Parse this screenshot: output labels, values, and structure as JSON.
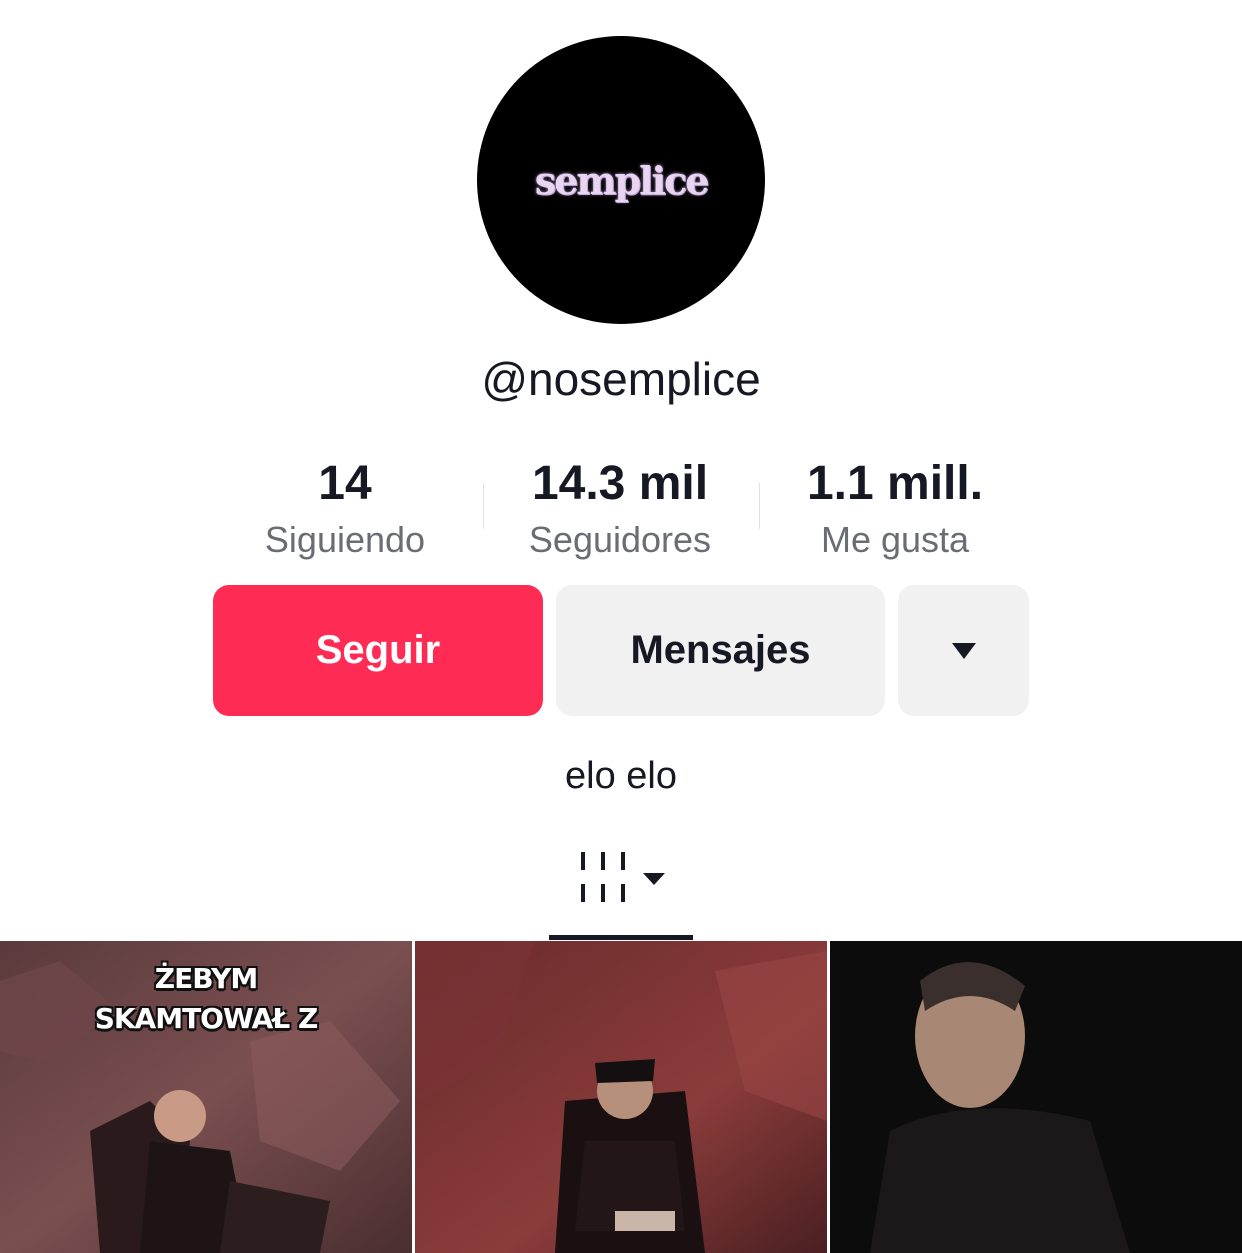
{
  "profile": {
    "avatar_text": "semplice",
    "handle": "@nosemplice",
    "bio": "elo elo"
  },
  "stats": [
    {
      "value": "14",
      "label": "Siguiendo"
    },
    {
      "value": "14.3 mil",
      "label": "Seguidores"
    },
    {
      "value": "1.1 mill.",
      "label": "Me gusta"
    }
  ],
  "actions": {
    "follow_label": "Seguir",
    "message_label": "Mensajes",
    "more_icon": "caret-down-icon"
  },
  "tabs": {
    "videos_icon": "video-grid-icon",
    "dropdown_icon": "caret-down-icon"
  },
  "videos": [
    {
      "caption": "ŻEBYM\nSKAMTOWAŁ Z"
    },
    {
      "caption": ""
    },
    {
      "caption": ""
    }
  ],
  "colors": {
    "accent": "#fe2c55",
    "button_gray": "#f1f1f2",
    "text": "#161823",
    "secondary_text": "#6b6d75"
  }
}
